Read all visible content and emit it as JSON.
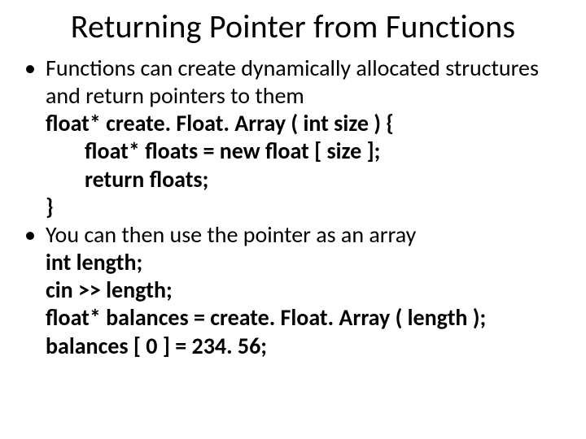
{
  "title": "Returning Pointer from Functions",
  "bullets": [
    {
      "lead": "Functions can create dynamically allocated structures and return pointers to them",
      "code": {
        "l1": "float* create. Float. Array ( int size ) {",
        "l2": "float* floats = new float [ size ];",
        "l3": "return floats;",
        "l4": "}"
      }
    },
    {
      "lead": "You can then use the pointer as an array",
      "code": {
        "l1": "int length;",
        "l2": "cin >> length;",
        "l3": "float* balances = create. Float. Array ( length );",
        "l4": "balances [ 0 ] = 234. 56;"
      }
    }
  ]
}
